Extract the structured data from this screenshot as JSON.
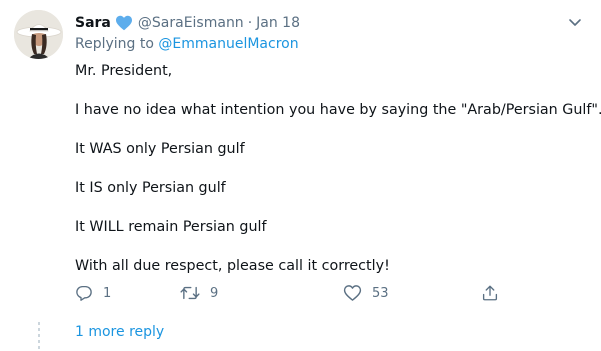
{
  "tweet": {
    "author_name": "Sara",
    "handle": "@SaraEismann",
    "separator": "·",
    "date": "Jan 18",
    "replying_prefix": "Replying to ",
    "replying_to": "@EmmanuelMacron",
    "paragraphs": [
      "Mr. President,",
      "I have no idea what intention you have by saying the \"Arab/Persian Gulf\".",
      "It WAS only Persian gulf",
      "It IS only Persian gulf",
      "It WILL remain Persian gulf",
      "With all due respect, please call it correctly!"
    ],
    "reply_count": "1",
    "retweet_count": "9",
    "like_count": "53"
  },
  "more_replies_label": "1 more reply",
  "icons": {
    "verified": "blue-heart-icon",
    "caret": "chevron-down-icon",
    "reply": "reply-icon",
    "retweet": "retweet-icon",
    "like": "heart-icon",
    "share": "share-icon"
  },
  "colors": {
    "link": "#1b95e0",
    "muted": "#5b7083",
    "heart": "#5dadec"
  }
}
